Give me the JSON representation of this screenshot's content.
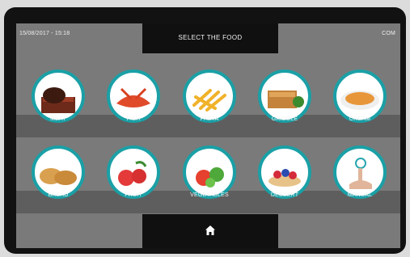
{
  "status": {
    "datetime": "15/08/2017 - 15:18",
    "right_text": "COM"
  },
  "header": {
    "title": "SELECT THE FOOD"
  },
  "foods": [
    {
      "label": "MEAT",
      "icon": "meat-icon"
    },
    {
      "label": "FISH",
      "icon": "fish-icon"
    },
    {
      "label": "PASTA",
      "icon": "pasta-icon"
    },
    {
      "label": "GRIDDLE",
      "icon": "griddle-icon"
    },
    {
      "label": "CREAM",
      "icon": "cream-icon"
    },
    {
      "label": "BREAD",
      "icon": "bread-icon"
    },
    {
      "label": "FRUIT",
      "icon": "fruit-icon"
    },
    {
      "label": "VEGETABLES",
      "icon": "vegetables-icon"
    },
    {
      "label": "DESSERT",
      "icon": "dessert-icon"
    },
    {
      "label": "MANUAL",
      "icon": "manual-icon"
    }
  ],
  "footer": {
    "home_icon": "home-icon"
  },
  "colors": {
    "ring": "#1aa0a6",
    "screen": "#7a7a7a",
    "tab": "#101010"
  }
}
